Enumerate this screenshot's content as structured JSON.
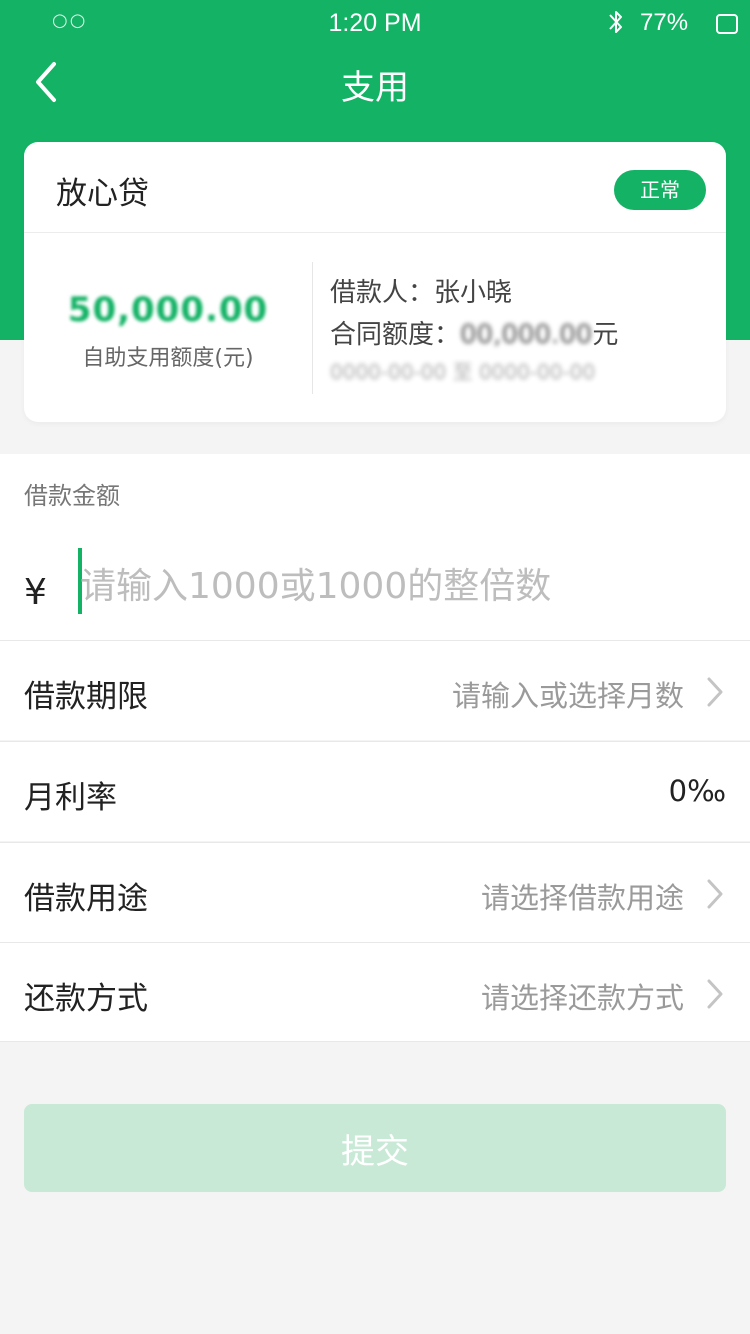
{
  "colors": {
    "brand": "#13b265",
    "background": "#f4f4f4",
    "submit_disabled": "#c8e9d6"
  },
  "status_bar": {
    "carrier": "○○",
    "time": "1:20 PM",
    "battery": "77%",
    "bluetooth_icon": "bluetooth-icon",
    "battery_icon": "battery-icon"
  },
  "nav": {
    "title": "支用",
    "back_icon": "back-chevron-icon"
  },
  "loan_card": {
    "product_name": "放心贷",
    "status_badge": "正常",
    "available_amount": "50,000.00",
    "available_label": "自助支用额度(元)",
    "borrower_label": "借款人：",
    "borrower_name": "张小晓",
    "contract_label": "合同额度：",
    "contract_amount": "00,000.00",
    "contract_unit": "元",
    "contract_extra": "0000-00-00 至 0000-00-00"
  },
  "amount": {
    "label": "借款金额",
    "currency_symbol": "¥",
    "placeholder": "请输入1000或1000的整倍数",
    "value": ""
  },
  "rows": {
    "term": {
      "label": "借款期限",
      "value": "请输入或选择月数"
    },
    "rate": {
      "label": "月利率",
      "value": "0‰"
    },
    "purpose": {
      "label": "借款用途",
      "value": "请选择借款用途"
    },
    "repayment": {
      "label": "还款方式",
      "value": "请选择还款方式"
    }
  },
  "submit": {
    "label": "提交"
  }
}
